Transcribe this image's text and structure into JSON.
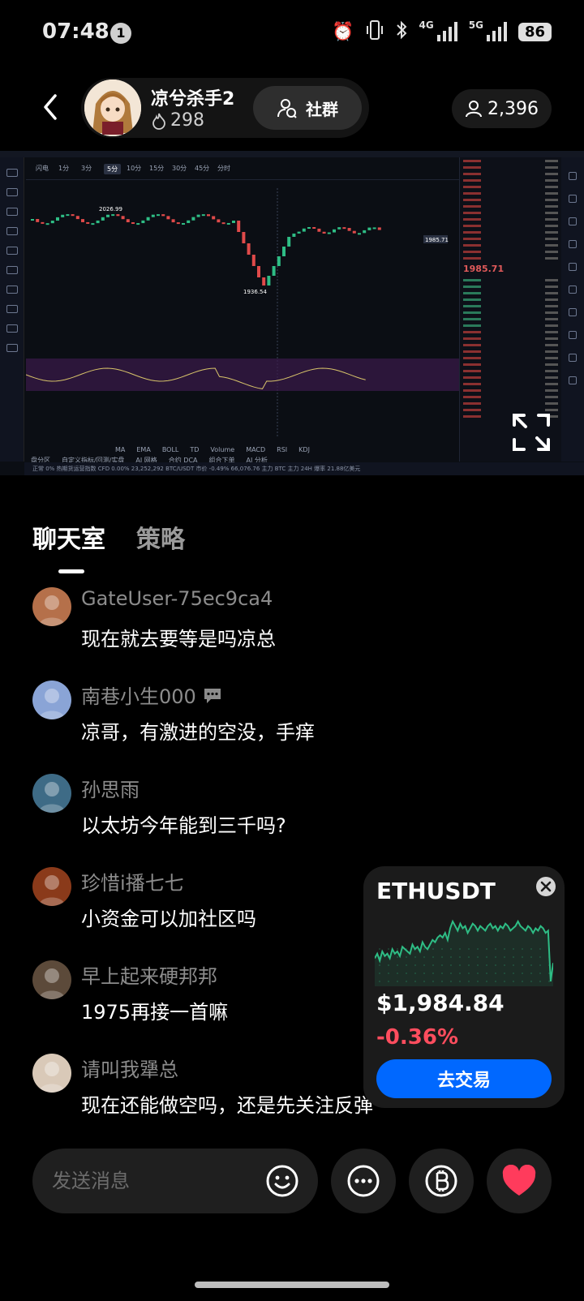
{
  "status_bar": {
    "time": "07:48",
    "notification_count": "1",
    "network_4g": "4G",
    "network_5g": "5G",
    "battery": "86"
  },
  "header": {
    "host_name": "凉兮杀手2",
    "host_likes": "298",
    "community_label": "社群",
    "viewer_count": "2,396"
  },
  "stream": {
    "timeframes": [
      "闪电",
      "1分",
      "3分",
      "5分",
      "10分",
      "15分",
      "30分",
      "45分",
      "分时"
    ],
    "active_timeframe": "5分",
    "high_label": "2026.99",
    "low_label": "1936.54",
    "current_price": "1985.71",
    "indicator_tabs": [
      "MA",
      "EMA",
      "BOLL",
      "TD",
      "Volume",
      "MACD",
      "RSI",
      "KDJ"
    ],
    "bottom_menu": [
      "盘分区",
      "自定义指标/回测/实盘",
      "AI 网格",
      "合约 DCA",
      "组合下单",
      "AI 分析"
    ],
    "status_text": "正常   0%     热期货运营指数 CFD  0.00%  23,252,292     BTC/USDT 市价  -0.49%  66,076.76     主力  BTC 主力 24H 爆率 21.88亿美元"
  },
  "tabs": {
    "chat": "聊天室",
    "strategy": "策略"
  },
  "messages": [
    {
      "user": "GateUser-75ec9ca4",
      "text": "现在就去要等是吗凉总",
      "avatar_color": "#b5704a"
    },
    {
      "user": "南巷小生000",
      "text": "凉哥，有激进的空没，手痒",
      "avatar_color": "#8aa4d6",
      "has_badge": true
    },
    {
      "user": "孙思雨",
      "text": "以太坊今年能到三千吗?",
      "avatar_color": "#3e6b86"
    },
    {
      "user": "珍惜i播七七",
      "text": "小资金可以加社区吗",
      "avatar_color": "#8a3a1a"
    },
    {
      "user": "早上起来硬邦邦",
      "text": "1975再接一首嘛",
      "avatar_color": "#5c4a3a"
    },
    {
      "user": "请叫我犟总",
      "text": "现在还能做空吗，还是先关注反弹",
      "avatar_color": "#d9c9b8"
    }
  ],
  "ticker": {
    "symbol": "ETHUSDT",
    "price": "$1,984.84",
    "change": "-0.36%",
    "trade_label": "去交易",
    "spark": [
      22,
      24,
      21,
      25,
      23,
      24,
      22,
      26,
      24,
      25,
      23,
      27,
      26,
      25,
      24,
      28,
      26,
      27,
      25,
      29,
      27,
      26,
      28,
      30,
      29,
      31,
      32,
      31,
      33,
      30,
      35,
      38,
      36,
      34,
      37,
      35,
      36,
      33,
      35,
      37,
      36,
      34,
      36,
      35,
      34,
      36,
      37,
      35,
      36,
      34,
      36,
      35,
      37,
      36,
      34,
      35,
      36,
      38,
      36,
      35,
      34,
      36,
      35,
      33,
      35,
      34,
      36,
      35,
      33,
      34,
      12,
      20
    ]
  },
  "input": {
    "placeholder": "发送消息"
  },
  "colors": {
    "accent": "#0068ff",
    "down": "#ff4d5e",
    "spark": "#2ebd85",
    "like": "#ff3b5c"
  }
}
